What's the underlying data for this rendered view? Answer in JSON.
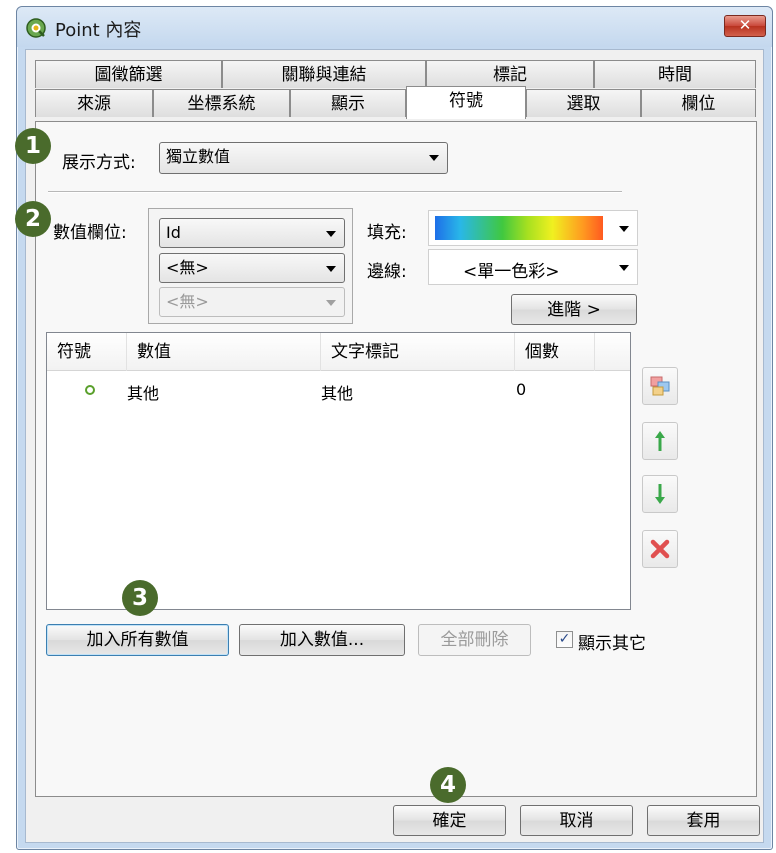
{
  "window": {
    "title": "Point 內容",
    "close_label": "✕"
  },
  "tabs": {
    "row1": [
      "圖徵篩選",
      "關聯與連結",
      "標記",
      "時間"
    ],
    "row2": [
      "來源",
      "坐標系統",
      "顯示",
      "符號",
      "選取",
      "欄位"
    ],
    "active": "符號"
  },
  "badges": [
    "1",
    "2",
    "3",
    "4"
  ],
  "display_mode": {
    "label": "展示方式:",
    "value": "獨立數值"
  },
  "value_fields": {
    "label": "數值欄位:",
    "field1": "Id",
    "field2": "<無>",
    "field3": "<無>"
  },
  "fill": {
    "label": "填充:"
  },
  "stroke": {
    "label": "邊線:",
    "value": "<單一色彩>"
  },
  "advanced_button": "進階 >",
  "symbol_table": {
    "columns": [
      "符號",
      "數值",
      "文字標記",
      "個數"
    ],
    "rows": [
      {
        "value": "其他",
        "label": "其他",
        "count": "0"
      }
    ]
  },
  "buttons": {
    "add_all": "加入所有數值",
    "add_value": "加入數值...",
    "remove_all": "全部刪除",
    "show_other": "顯示其它",
    "show_other_checked": true
  },
  "footer": {
    "ok": "確定",
    "cancel": "取消",
    "apply": "套用"
  },
  "colors": {
    "badge": "#4a6b2c",
    "symbol_point": "#5aa02c"
  }
}
